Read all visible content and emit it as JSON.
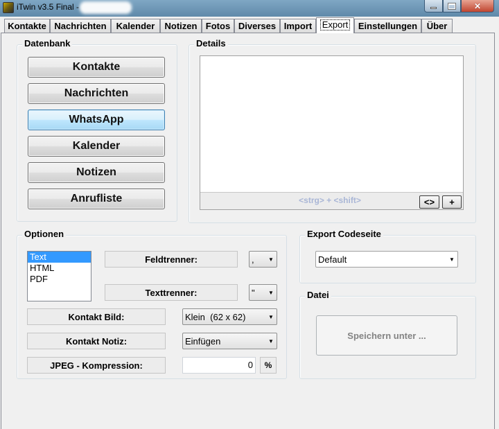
{
  "window": {
    "title": "iTwin v3.5 Final -"
  },
  "tabs": [
    {
      "label": "Kontakte"
    },
    {
      "label": "Nachrichten"
    },
    {
      "label": "Kalender"
    },
    {
      "label": "Notizen"
    },
    {
      "label": "Fotos"
    },
    {
      "label": "Diverses"
    },
    {
      "label": "Import"
    },
    {
      "label": "Export"
    },
    {
      "label": "Einstellungen"
    },
    {
      "label": "Über"
    }
  ],
  "active_tab": "Export",
  "datenbank": {
    "title": "Datenbank",
    "buttons": [
      {
        "label": "Kontakte"
      },
      {
        "label": "Nachrichten"
      },
      {
        "label": "WhatsApp"
      },
      {
        "label": "Kalender"
      },
      {
        "label": "Notizen"
      },
      {
        "label": "Anrufliste"
      }
    ],
    "active": "WhatsApp"
  },
  "details": {
    "title": "Details",
    "hint": "<strg> + <shift>",
    "toggle_label": "<>",
    "add_label": "+"
  },
  "optionen": {
    "title": "Optionen",
    "formats": [
      "Text",
      "HTML",
      "PDF"
    ],
    "selected_format": "Text",
    "feldtrenner": {
      "label": "Feldtrenner:",
      "value": ","
    },
    "texttrenner": {
      "label": "Texttrenner:",
      "value": "\""
    },
    "kontakt_bild": {
      "label": "Kontakt Bild:",
      "value": "Klein  (62 x 62)"
    },
    "kontakt_notiz": {
      "label": "Kontakt Notiz:",
      "value": "Einfügen"
    },
    "jpeg": {
      "label": "JPEG - Kompression:",
      "value": "0",
      "unit": "%"
    }
  },
  "codeseite": {
    "title": "Export Codeseite",
    "value": "Default"
  },
  "datei": {
    "title": "Datei",
    "save_label": "Speichern unter ..."
  },
  "colors": {
    "titlebar": "#6f98b7",
    "selection": "#3399ff",
    "active_button": "#bee6fd",
    "hint_text": "#a9b6d6",
    "disabled_text": "#838383"
  }
}
